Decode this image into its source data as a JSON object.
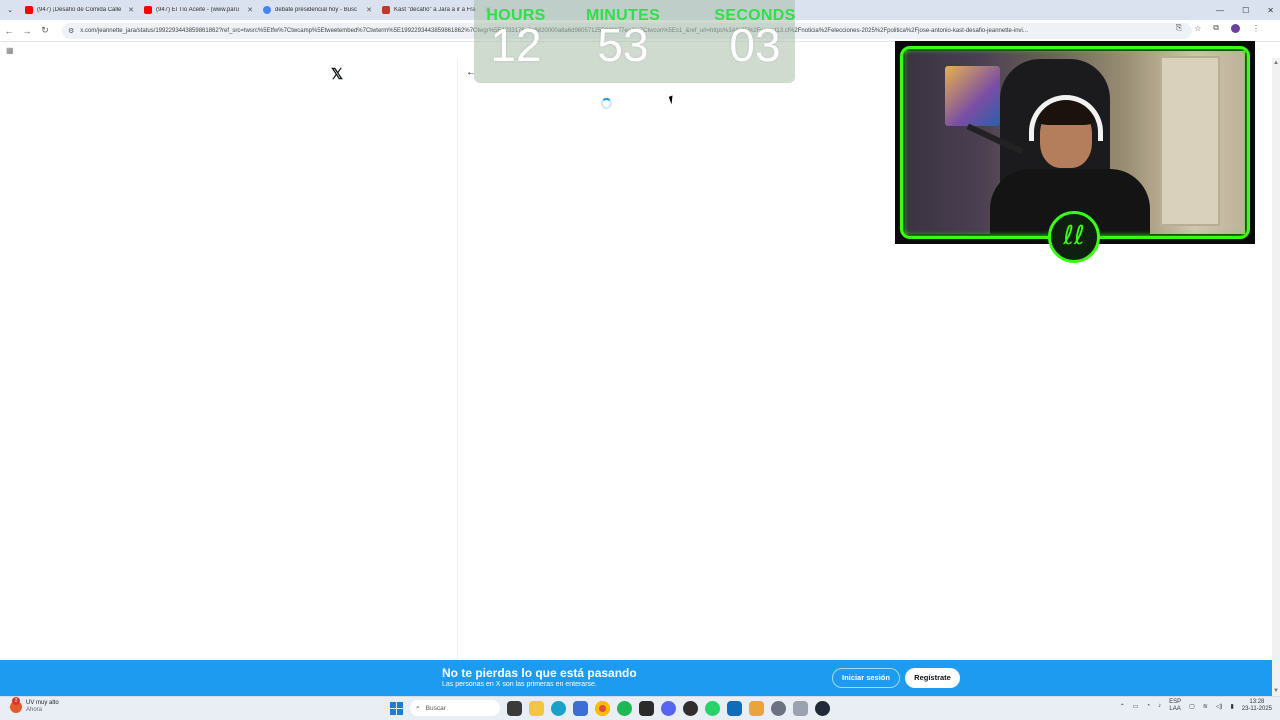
{
  "browser": {
    "tabs": [
      {
        "label": "(947) ¡Desafío de Comida Calle",
        "color": "#ff0000"
      },
      {
        "label": "(947) El Tío Aceite - (www.paru",
        "color": "#ff0000"
      },
      {
        "label": "debate presidencial hoy - Busc",
        "color": "#4285f4"
      },
      {
        "label": "Kast \"decafío\" a Jara a ir a Fra",
        "color": "#c0392b"
      }
    ],
    "url": "x.com/jeannette_jara/status/1992293443859861862?ref_src=twsrc%5Etfw%7Ctwcamp%5Etweetembed%7Ctwterm%5E1992293443859861862%7Ctwgr%5E4233176a9c8820000a8a6d980571255246b77ea4%7Ctwcon%5Es1_&ref_url=https%3A%2F%2Fwww.t13.cl%2Fnoticia%2Felecciones-2025%2Fpolitica%2Fjose-antonio-kast-desafio-jeannette-invi..."
  },
  "countdown": {
    "hours_label": "HOURS",
    "minutes_label": "MINUTES",
    "seconds_label": "SECONDS",
    "hours": "12",
    "minutes": "53",
    "seconds": "03",
    "label_color": "#2ee04a"
  },
  "x_page": {
    "logo": "𝕏",
    "back_arrow": "←"
  },
  "banner": {
    "title": "No te pierdas lo que está pasando",
    "subtitle": "Las personas en X son las primeras en enterarse.",
    "login_label": "Iniciar sesión",
    "signup_label": "Regístrate",
    "color": "#1d9bf0"
  },
  "taskbar": {
    "weather_title": "UV muy alto",
    "weather_sub": "Ahora",
    "weather_badge": "2",
    "search_placeholder": "Buscar",
    "lang_top": "ESP",
    "lang_bottom": "LAA",
    "time": "13:28",
    "date": "23-11-2025"
  },
  "webcam": {
    "badge_glyph": "ℓℓ",
    "frame_color": "#39ff14"
  }
}
